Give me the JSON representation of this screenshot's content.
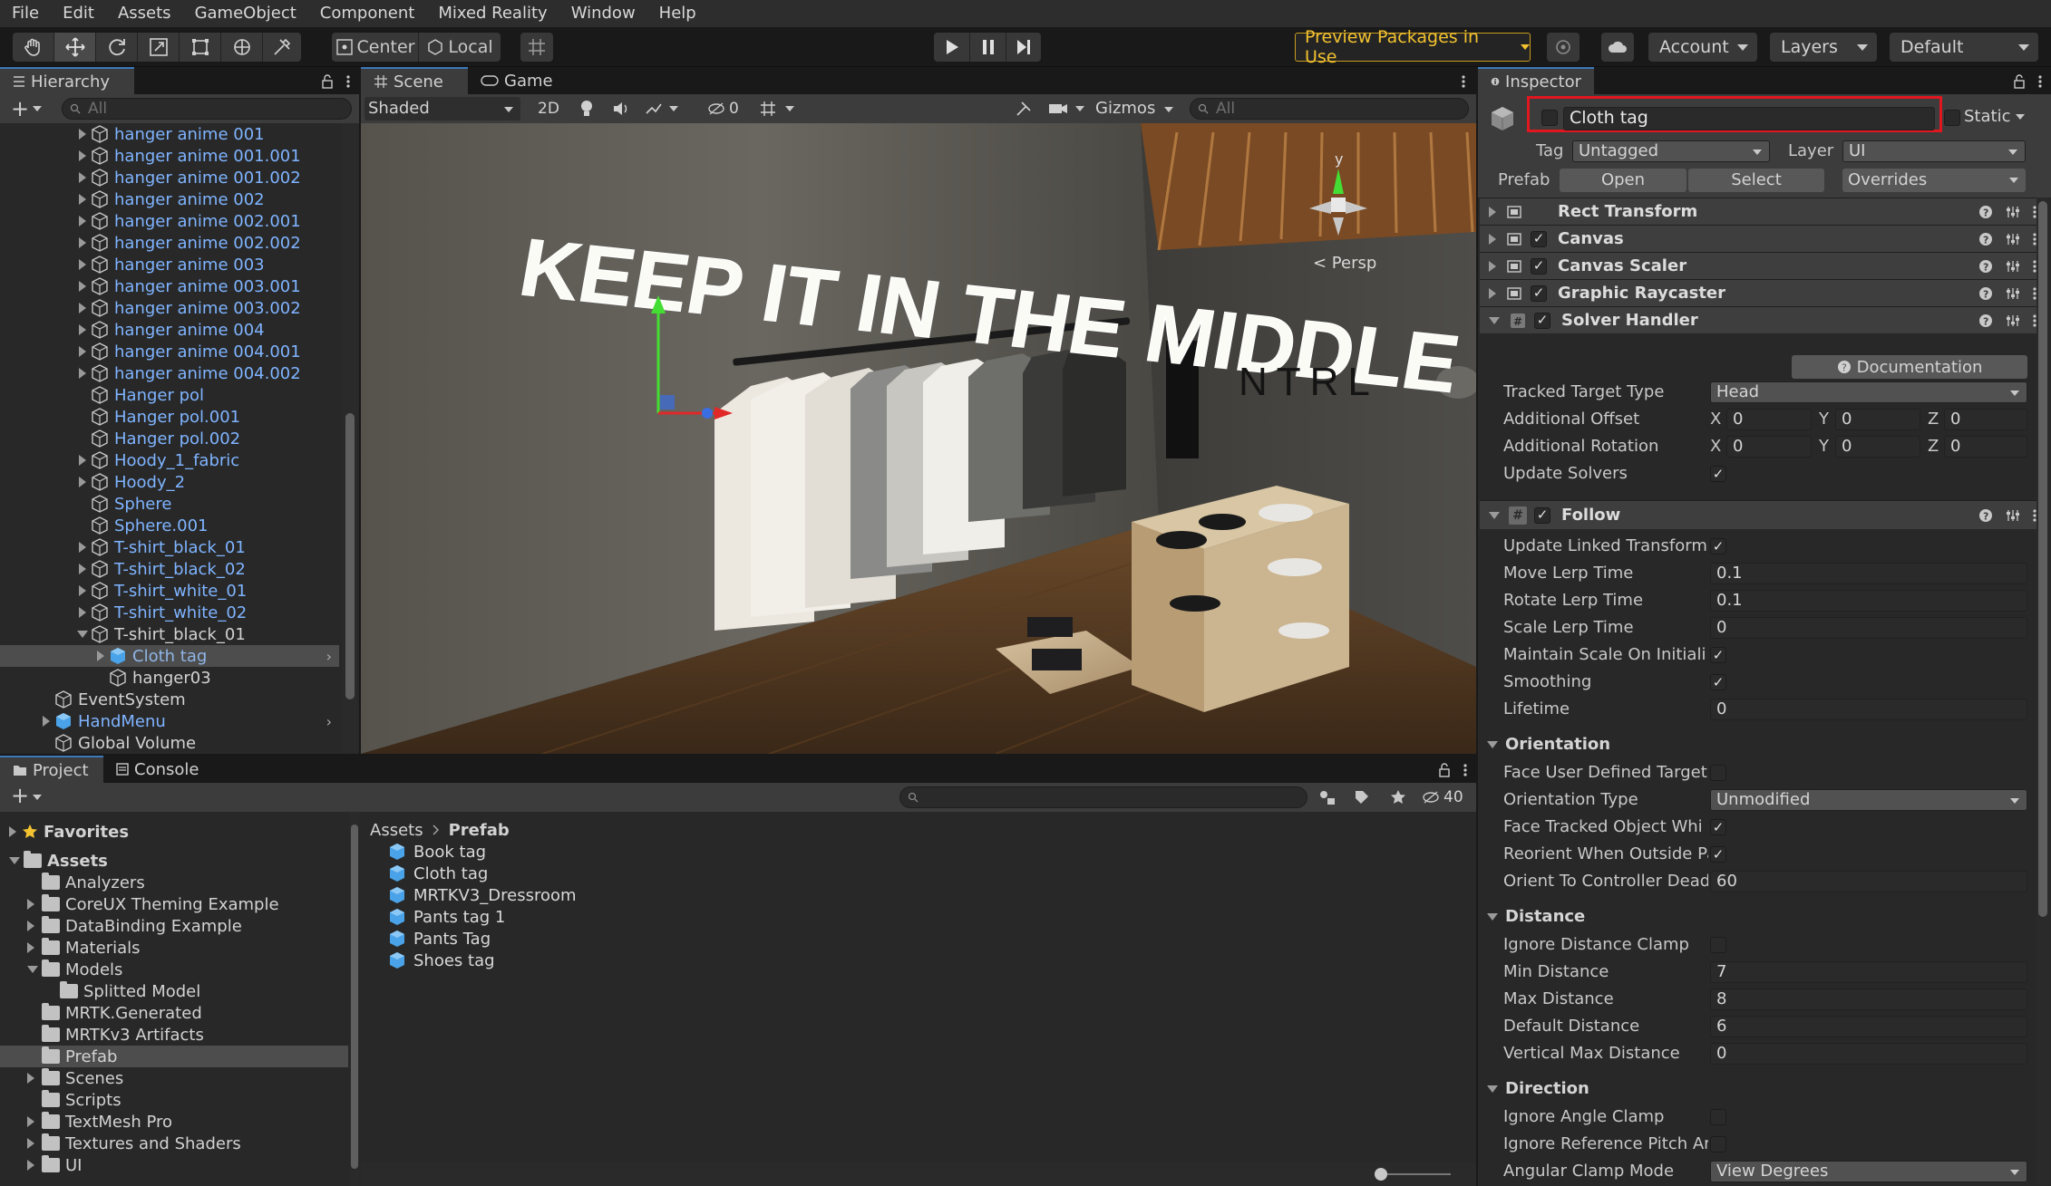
{
  "menubar": {
    "items": [
      "File",
      "Edit",
      "Assets",
      "GameObject",
      "Component",
      "Mixed Reality",
      "Window",
      "Help"
    ]
  },
  "toolbar": {
    "tools": [
      "hand-tool-icon",
      "move-tool-icon",
      "rotate-tool-icon",
      "scale-tool-icon",
      "rect-tool-icon",
      "transform-tool-icon",
      "custom-tool-icon"
    ],
    "pivot_mode": "Center",
    "pivot_rotation": "Local",
    "preview_packages": "Preview Packages in Use",
    "account": "Account",
    "layers": "Layers",
    "layout": "Default"
  },
  "hierarchy": {
    "tab": "Hierarchy",
    "search_placeholder": "All",
    "items": [
      {
        "label": "hanger anime 001",
        "arrow": true
      },
      {
        "label": "hanger anime 001.001",
        "arrow": true
      },
      {
        "label": "hanger anime 001.002",
        "arrow": true
      },
      {
        "label": "hanger anime 002",
        "arrow": true
      },
      {
        "label": "hanger anime 002.001",
        "arrow": true
      },
      {
        "label": "hanger anime 002.002",
        "arrow": true
      },
      {
        "label": "hanger anime 003",
        "arrow": true
      },
      {
        "label": "hanger anime 003.001",
        "arrow": true
      },
      {
        "label": "hanger anime 003.002",
        "arrow": true
      },
      {
        "label": "hanger anime 004",
        "arrow": true
      },
      {
        "label": "hanger anime 004.001",
        "arrow": true
      },
      {
        "label": "hanger anime 004.002",
        "arrow": true
      },
      {
        "label": "Hanger pol",
        "arrow": false
      },
      {
        "label": "Hanger pol.001",
        "arrow": false
      },
      {
        "label": "Hanger pol.002",
        "arrow": false
      },
      {
        "label": "Hoody_1_fabric",
        "arrow": true
      },
      {
        "label": "Hoody_2",
        "arrow": true
      },
      {
        "label": "Sphere",
        "arrow": false
      },
      {
        "label": "Sphere.001",
        "arrow": false
      },
      {
        "label": "T-shirt_black_01",
        "arrow": true
      },
      {
        "label": "T-shirt_black_02",
        "arrow": true
      },
      {
        "label": "T-shirt_white_01",
        "arrow": true
      },
      {
        "label": "T-shirt_white_02",
        "arrow": true
      },
      {
        "label": "T-shirt_black_01",
        "arrow": "down"
      },
      {
        "label": "Cloth tag",
        "arrow": true
      },
      {
        "label": "hanger03",
        "arrow": false
      },
      {
        "label": "EventSystem",
        "arrow": false
      },
      {
        "label": "HandMenu",
        "arrow": true
      },
      {
        "label": "Global Volume",
        "arrow": false
      }
    ]
  },
  "scene": {
    "tabs": [
      "Scene",
      "Game"
    ],
    "shading": "Shaded",
    "mode_2d": "2D",
    "hidden_count": "0",
    "gizmos": "Gizmos",
    "search_placeholder": "All",
    "persp_label": "< Persp",
    "gizmo_axis": "y",
    "neon_sign": "KEEP IT IN THE MIDDLE",
    "wall_logo": "NTRL"
  },
  "project": {
    "tabs": [
      "Project",
      "Console"
    ],
    "favorites": "Favorites",
    "hidden_count": "40",
    "tree": [
      {
        "label": "Assets",
        "level": 0,
        "arrow": "down"
      },
      {
        "label": "Analyzers",
        "level": 1,
        "arrow": false
      },
      {
        "label": "CoreUX Theming Example",
        "level": 1,
        "arrow": true
      },
      {
        "label": "DataBinding Example",
        "level": 1,
        "arrow": true
      },
      {
        "label": "Materials",
        "level": 1,
        "arrow": true
      },
      {
        "label": "Models",
        "level": 1,
        "arrow": "down"
      },
      {
        "label": "Splitted Model",
        "level": 2,
        "arrow": false
      },
      {
        "label": "MRTK.Generated",
        "level": 1,
        "arrow": false
      },
      {
        "label": "MRTKv3 Artifacts",
        "level": 1,
        "arrow": false
      },
      {
        "label": "Prefab",
        "level": 1,
        "arrow": false
      },
      {
        "label": "Scenes",
        "level": 1,
        "arrow": true
      },
      {
        "label": "Scripts",
        "level": 1,
        "arrow": false
      },
      {
        "label": "TextMesh Pro",
        "level": 1,
        "arrow": true
      },
      {
        "label": "Textures and Shaders",
        "level": 1,
        "arrow": true
      },
      {
        "label": "UI",
        "level": 1,
        "arrow": true
      }
    ],
    "breadcrumb": [
      "Assets",
      "Prefab"
    ],
    "assets": [
      "Book tag",
      "Cloth tag",
      "MRTKV3_Dressroom",
      "Pants tag 1",
      "Pants Tag",
      "Shoes tag"
    ]
  },
  "inspector": {
    "tab": "Inspector",
    "object_name": "Cloth tag",
    "static_label": "Static",
    "tag_label": "Tag",
    "tag_value": "Untagged",
    "layer_label": "Layer",
    "layer_value": "UI",
    "prefab_label": "Prefab",
    "prefab_open": "Open",
    "prefab_select": "Select",
    "prefab_overrides": "Overrides",
    "components": [
      "Rect Transform",
      "Canvas",
      "Canvas Scaler",
      "Graphic Raycaster",
      "Solver Handler"
    ],
    "documentation": "Documentation",
    "solver": {
      "tracked_target_type_label": "Tracked Target Type",
      "tracked_target_type": "Head",
      "additional_offset_label": "Additional Offset",
      "additional_rotation_label": "Additional Rotation",
      "offset": {
        "x": "0",
        "y": "0",
        "z": "0"
      },
      "rotation": {
        "x": "0",
        "y": "0",
        "z": "0"
      },
      "update_solvers_label": "Update Solvers"
    },
    "follow": {
      "title": "Follow",
      "update_linked_transform": "Update Linked Transform",
      "move_lerp_time_label": "Move Lerp Time",
      "move_lerp_time": "0.1",
      "rotate_lerp_time_label": "Rotate Lerp Time",
      "rotate_lerp_time": "0.1",
      "scale_lerp_time_label": "Scale Lerp Time",
      "scale_lerp_time": "0",
      "maintain_scale_label": "Maintain Scale On Initiali",
      "smoothing_label": "Smoothing",
      "lifetime_label": "Lifetime",
      "lifetime": "0"
    },
    "orientation": {
      "title": "Orientation",
      "face_user_label": "Face User Defined Target",
      "orientation_type_label": "Orientation Type",
      "orientation_type": "Unmodified",
      "face_tracked_label": "Face Tracked Object Whi",
      "reorient_label": "Reorient When Outside Pa",
      "orient_controller_label": "Orient To Controller Dead",
      "orient_controller": "60"
    },
    "distance": {
      "title": "Distance",
      "ignore_clamp_label": "Ignore Distance Clamp",
      "min_label": "Min Distance",
      "min": "7",
      "max_label": "Max Distance",
      "max": "8",
      "default_label": "Default Distance",
      "default": "6",
      "vertical_max_label": "Vertical Max Distance",
      "vertical_max": "0"
    },
    "direction": {
      "title": "Direction",
      "ignore_angle_label": "Ignore Angle Clamp",
      "ignore_pitch_label": "Ignore Reference Pitch Ar",
      "angular_mode_label": "Angular Clamp Mode",
      "angular_mode": "View Degrees"
    }
  },
  "colors": {
    "accent": "#3a79bb",
    "highlight_box": "#e0171f",
    "preview_text": "#f2c230",
    "hierarchy_blue": "#7fb4ff"
  }
}
